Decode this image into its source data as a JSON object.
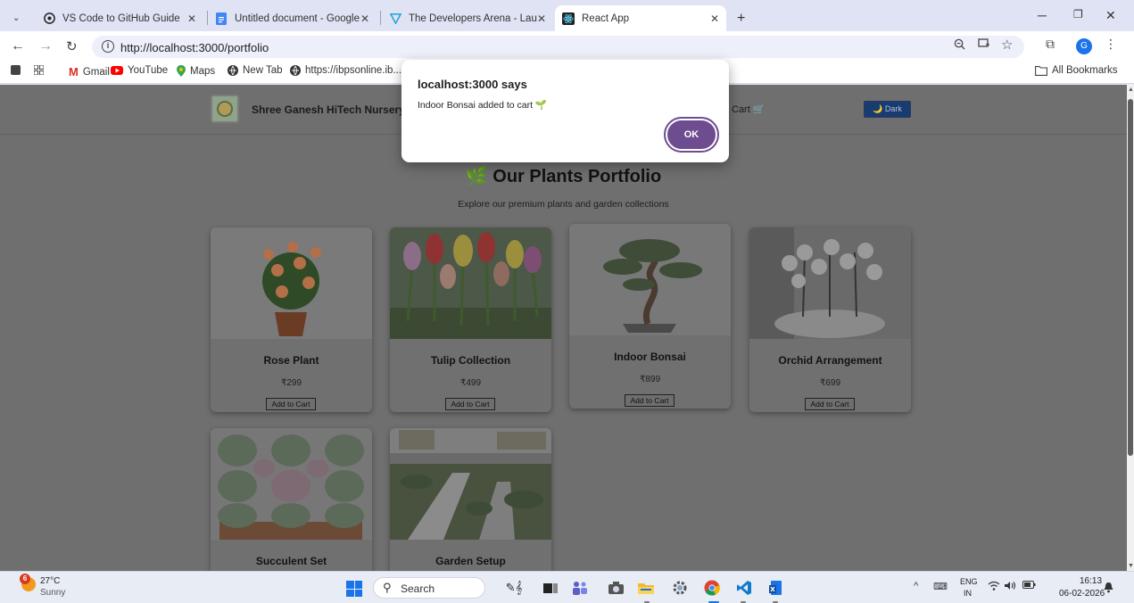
{
  "browser": {
    "tabs": [
      {
        "title": "VS Code to GitHub Guide",
        "close": "✕"
      },
      {
        "title": "Untitled document - Google Do",
        "close": "✕"
      },
      {
        "title": "The Developers Arena - Launch",
        "close": "✕"
      },
      {
        "title": "React App",
        "close": "✕"
      }
    ],
    "new_tab": "+",
    "url": "http://localhost:3000/portfolio",
    "profile_initial": "G",
    "bookmarks": [
      "Gmail",
      "YouTube",
      "Maps",
      "New Tab",
      "https://ibpsonline.ib..."
    ],
    "all_bookmarks": "All Bookmarks"
  },
  "site": {
    "brand": "Shree Ganesh HiTech Nursery",
    "nav_cart": "Cart 🛒",
    "dark_button": "🌙 Dark",
    "portfolio_title": "🌿 Our Plants Portfolio",
    "portfolio_subtitle": "Explore our premium plants and garden collections",
    "add_to_cart": "Add to Cart",
    "products": [
      {
        "name": "Rose Plant",
        "price": "₹299"
      },
      {
        "name": "Tulip Collection",
        "price": "₹499"
      },
      {
        "name": "Indoor Bonsai",
        "price": "₹899"
      },
      {
        "name": "Orchid Arrangement",
        "price": "₹699"
      },
      {
        "name": "Succulent Set",
        "price": ""
      },
      {
        "name": "Garden Setup",
        "price": ""
      }
    ]
  },
  "dialog": {
    "title": "localhost:3000 says",
    "message": "Indoor Bonsai added to cart 🌱",
    "ok": "OK"
  },
  "taskbar": {
    "weather_badge": "6",
    "temperature": "27°C",
    "condition": "Sunny",
    "search": "Search",
    "lang_top": "ENG",
    "lang_bottom": "IN",
    "time": "16:13",
    "date": "06-02-2026"
  },
  "colors": {
    "dialog_button": "#6d4c8f",
    "dark_button": "#183b72",
    "page_overlay": "#6f6f6f",
    "tab_strip": "#dfe3f3"
  }
}
